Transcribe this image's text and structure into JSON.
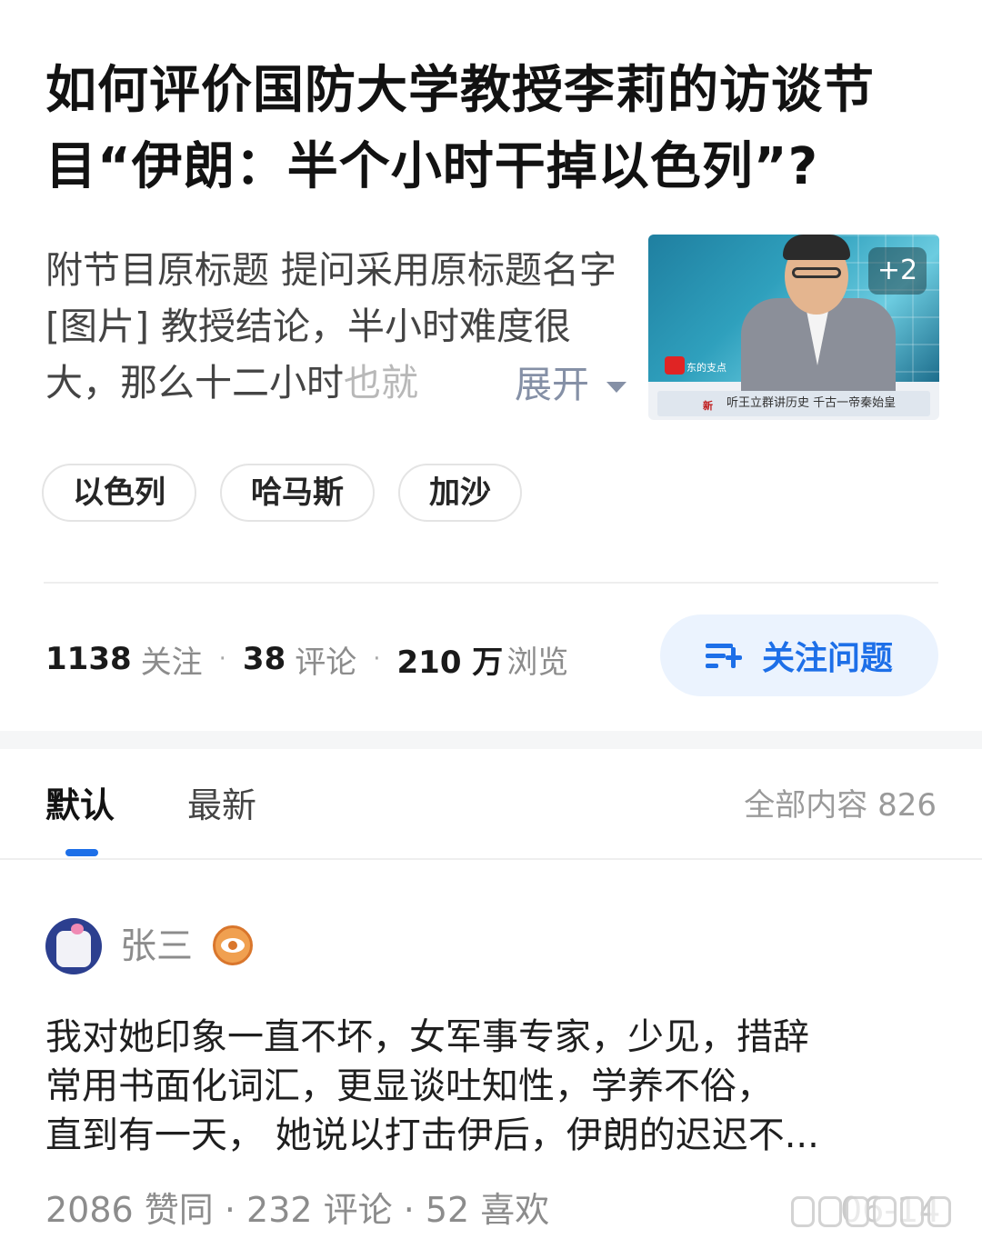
{
  "question": {
    "title": "如何评价国防大学教授李莉的访谈节目“伊朗：半个小时干掉以色列”?",
    "excerpt_main": "附节目原标题 提问采用原标题名字 [图片] 教授结论，半小时难度很大，那么十二小时",
    "excerpt_fade": "也就",
    "expand_label": "展开",
    "thumbnail": {
      "more_count": "+2",
      "caption": "听王立群讲历史 千古一帝秦始皇",
      "caption_logo": "新",
      "channel_text": "东的支点"
    },
    "tags": [
      "以色列",
      "哈马斯",
      "加沙"
    ],
    "stats": {
      "followers": "1138",
      "followers_label": "关注",
      "comments": "38",
      "comments_label": "评论",
      "views": "210 万",
      "views_label": "浏览"
    },
    "follow_button_label": "关注问题"
  },
  "tabs": {
    "default_label": "默认",
    "latest_label": "最新",
    "all_content_label": "全部内容 826"
  },
  "answer": {
    "author": "张三",
    "lines": [
      "我对她印象一直不坏，女军事专家，少见，措辞",
      "常用书面化词汇，更显谈吐知性，学养不俗，",
      "直到有一天， 她说以打击伊后，伊朗的迟迟不..."
    ],
    "meta": "2086 赞同 · 232 评论 · 52 喜欢",
    "date": "06-14"
  },
  "colors": {
    "accent": "#1d6fe8",
    "follow_bg": "#ebf3fe",
    "muted": "#8c8c8c"
  }
}
